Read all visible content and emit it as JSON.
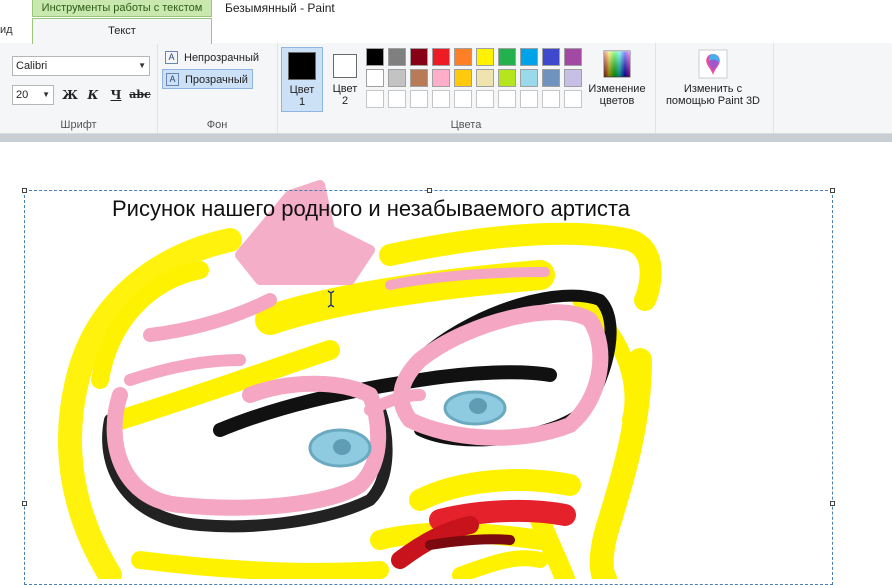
{
  "titlebar": {
    "contextual_tab_header": "Инструменты работы с текстом",
    "window_title": "Безымянный - Paint",
    "left_tab_fragment": "ид"
  },
  "tabs": {
    "active": "Текст"
  },
  "ribbon": {
    "font_group": {
      "label": "Шрифт",
      "font_family": "Calibri",
      "font_size": "20",
      "bold": "Ж",
      "italic": "К",
      "underline": "Ч",
      "strike": "abc"
    },
    "background_group": {
      "label": "Фон",
      "opaque": "Непрозрачный",
      "transparent": "Прозрачный"
    },
    "colors_group": {
      "label": "Цвета",
      "color1_label": "Цвет 1",
      "color2_label": "Цвет 2",
      "color1_value": "#000000",
      "color2_value": "#ffffff",
      "edit_colors_label": "Изменение цветов",
      "palette": [
        [
          "#000000",
          "#7f7f7f",
          "#880015",
          "#ed1c24",
          "#ff7f27",
          "#fff200",
          "#22b14c",
          "#00a2e8",
          "#3f48cc",
          "#a349a4"
        ],
        [
          "#ffffff",
          "#c3c3c3",
          "#b97a57",
          "#ffaec9",
          "#ffc90e",
          "#efe4b0",
          "#b5e61d",
          "#99d9ea",
          "#7092be",
          "#c8bfe7"
        ],
        [
          "#ffffff",
          "#ffffff",
          "#ffffff",
          "#ffffff",
          "#ffffff",
          "#ffffff",
          "#ffffff",
          "#ffffff",
          "#ffffff",
          "#ffffff"
        ]
      ]
    },
    "paint3d": {
      "label": "Изменить с помощью Paint 3D"
    }
  },
  "canvas": {
    "text": "Рисунок нашего родного и незабываемого артиста"
  },
  "colors": {
    "accent_green": "#c8e8b0",
    "selection_blue": "#cce1f6",
    "paint_yellow": "#fff200",
    "paint_pink": "#f4a6c3",
    "paint_black": "#111111",
    "paint_lightblue": "#8fcbe0",
    "paint_red": "#e5222b"
  }
}
